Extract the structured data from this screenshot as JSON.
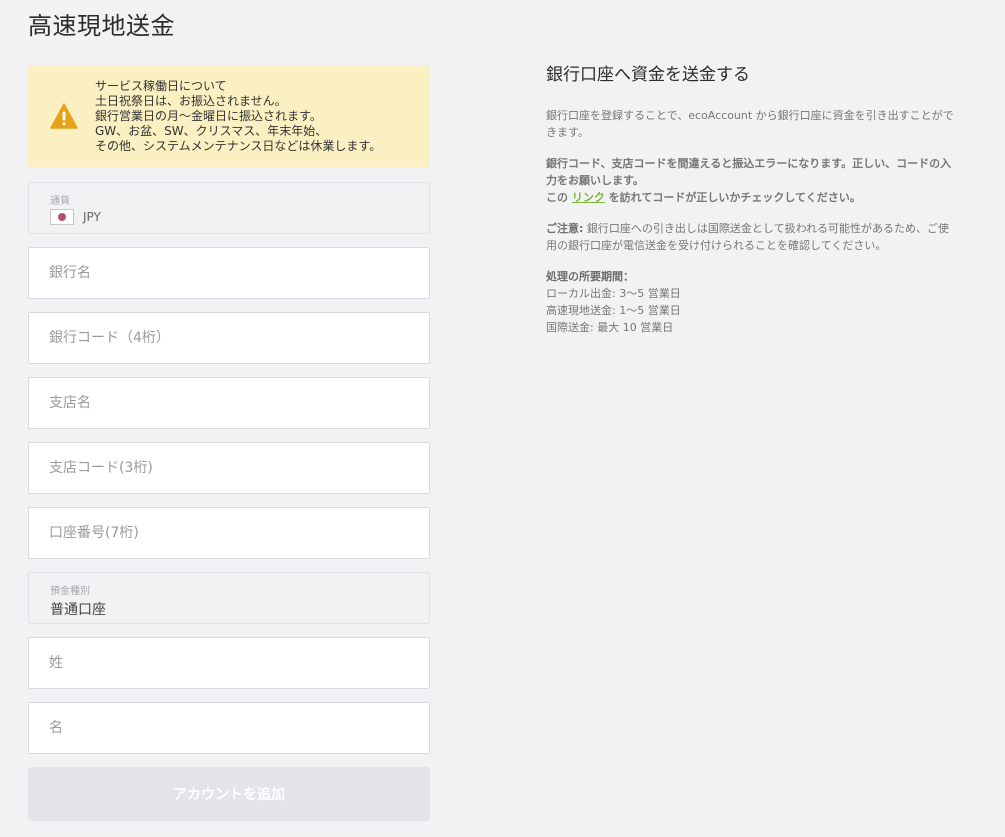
{
  "page": {
    "title": "高速現地送金"
  },
  "notice": {
    "icon": "warning-icon",
    "icon_color": "#e8a21a",
    "lines": [
      "サービス稼働日について",
      "土日祝祭日は、お振込されません。",
      "銀行営業日の月～金曜日に振込されます。",
      "GW、お盆、SW、クリスマス、年末年始、",
      "その他、システムメンテナンス日などは休業します。"
    ]
  },
  "form": {
    "currency": {
      "label": "通貨",
      "value": "JPY",
      "flag": "japan-flag-icon"
    },
    "bank_name": {
      "placeholder": "銀行名"
    },
    "bank_code": {
      "placeholder": "銀行コード（4桁）"
    },
    "branch_name": {
      "placeholder": "支店名"
    },
    "branch_code": {
      "placeholder": "支店コード(3桁)"
    },
    "account_number": {
      "placeholder": "口座番号(7桁)"
    },
    "account_type": {
      "label": "預金種別",
      "value": "普通口座"
    },
    "last_name": {
      "placeholder": "姓"
    },
    "first_name": {
      "placeholder": "名"
    },
    "submit_label": "アカウントを追加"
  },
  "info": {
    "heading": "銀行口座へ資金を送金する",
    "p1": "銀行口座を登録することで、ecoAccount から銀行口座に資金を引き出すことができます。",
    "p2": "銀行コード、支店コードを間違えると振込エラーになります。正しい、コードの入力をお願いします。",
    "p3_before": "この",
    "p3_link": "リンク",
    "p3_after": "を訪れてコードが正しいかチェックしてください。",
    "caution_label": "ご注意:",
    "caution_text": "銀行口座への引き出しは国際送金として扱われる可能性があるため、ご使用の銀行口座が電信送金を受け付けられることを確認してください。",
    "processing_title": "処理の所要期間：",
    "processing_items": [
      "ローカル出金: 3～5 営業日",
      "高速現地送金: 1～5 営業日",
      "国際送金: 最大 10 営業日"
    ],
    "link_color": "#7bb23a"
  }
}
